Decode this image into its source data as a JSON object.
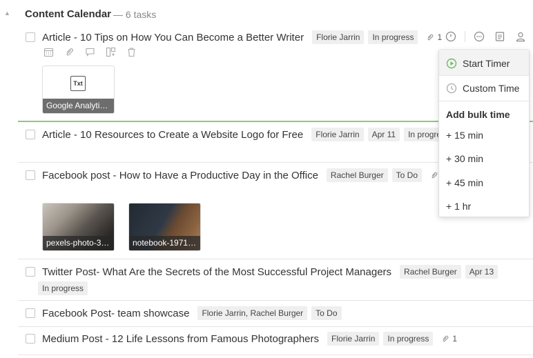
{
  "list": {
    "title": "Content Calendar",
    "count": "— 6 tasks"
  },
  "tasks": [
    {
      "title": "Article - 10 Tips on How You Can Become a Better Writer",
      "tags": [
        "Florie Jarrin",
        "In progress"
      ],
      "attachments": "1",
      "files": [
        {
          "name": "Google Analyti…",
          "kind": "Txt"
        }
      ]
    },
    {
      "title": "Article - 10 Resources to Create a Website Logo for Free",
      "tags": [
        "Florie Jarrin",
        "Apr 11",
        "In progress"
      ]
    },
    {
      "title": "Facebook post - How to Have a Productive Day in the Office",
      "tags": [
        "Rachel Burger",
        "To Do"
      ],
      "attachments": "2",
      "files": [
        {
          "name": "pexels-photo-3…"
        },
        {
          "name": "notebook-1971…"
        }
      ]
    },
    {
      "title": "Twitter Post- What Are the Secrets of the Most Successful Project Managers",
      "tags": [
        "Rachel Burger",
        "Apr 13",
        "In progress"
      ]
    },
    {
      "title": "Facebook Post- team showcase",
      "tags": [
        "Florie Jarrin, Rachel Burger",
        "To Do"
      ]
    },
    {
      "title": "Medium Post - 12 Life Lessons from Famous Photographers",
      "tags": [
        "Florie Jarrin",
        "In progress"
      ],
      "attachments": "1"
    }
  ],
  "timer_menu": {
    "start_timer": "Start Timer",
    "custom_time": "Custom Time",
    "bulk_heading": "Add bulk time",
    "bulk_options": [
      "+ 15 min",
      "+ 30 min",
      "+ 45 min",
      "+ 1 hr"
    ]
  },
  "colors": {
    "accent_green": "#6cbb5a",
    "tag_bg": "#efefef"
  },
  "icons": [
    "calendar-icon",
    "paperclip-icon",
    "comment-icon",
    "subtask-icon",
    "trash-icon",
    "clock-icon",
    "more-icon",
    "notes-icon",
    "user-icon",
    "play-icon"
  ]
}
